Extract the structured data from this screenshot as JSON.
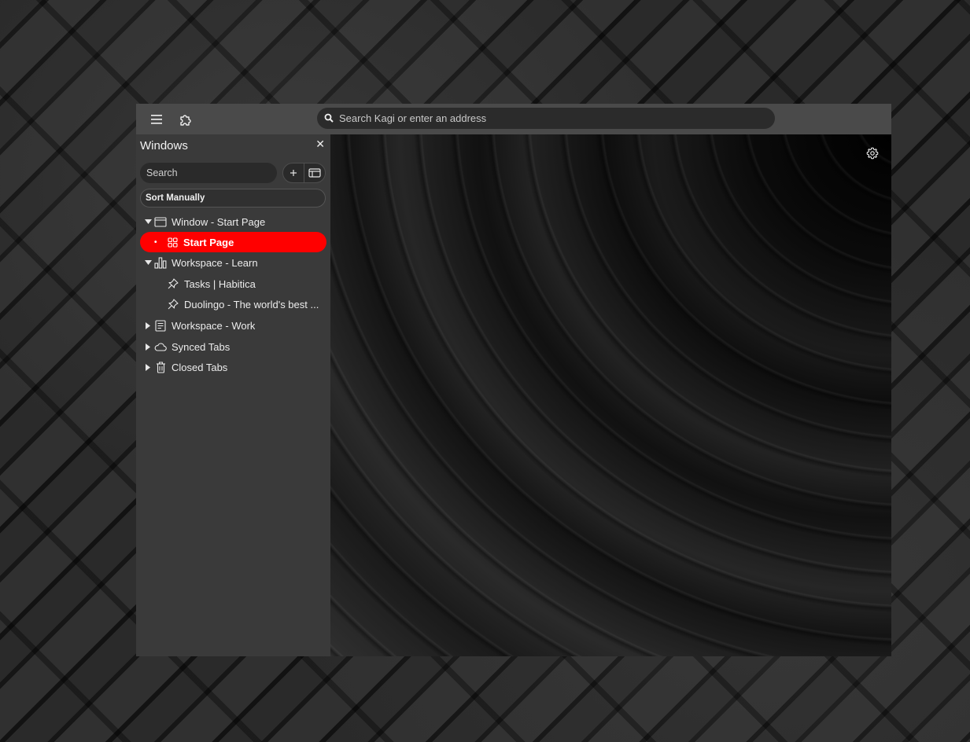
{
  "toolbar": {
    "menu_icon": "hamburger-menu-icon",
    "extensions_icon": "puzzle-icon",
    "address_placeholder": "Search Kagi or enter an address"
  },
  "panel": {
    "title": "Windows",
    "close_glyph": "✕",
    "search_placeholder": "Search",
    "new_tab_icon": "plus-icon",
    "new_window_icon": "window-icon",
    "sort_label": "Sort Manually",
    "items": [
      {
        "label": "Window - Start Page",
        "icon": "window-icon",
        "expanded": true,
        "level": 0
      },
      {
        "label": "Start Page",
        "icon": "grid-icon",
        "active": true,
        "level": 1
      },
      {
        "label": "Workspace - Learn",
        "icon": "chart-icon",
        "expanded": true,
        "level": 0
      },
      {
        "label": "Tasks | Habitica",
        "icon": "pin-icon",
        "level": 1
      },
      {
        "label": "Duolingo - The world's best ...",
        "icon": "pin-icon",
        "level": 1
      },
      {
        "label": "Workspace - Work",
        "icon": "document-icon",
        "expanded": false,
        "level": 0
      },
      {
        "label": "Synced Tabs",
        "icon": "cloud-icon",
        "expanded": false,
        "level": 0
      },
      {
        "label": "Closed Tabs",
        "icon": "trash-icon",
        "expanded": false,
        "level": 0
      }
    ]
  },
  "content": {
    "settings_icon": "gear-icon"
  },
  "colors": {
    "active_item": "#ff0000",
    "toolbar": "#4a4a4a",
    "panel": "#3a3a3a"
  }
}
